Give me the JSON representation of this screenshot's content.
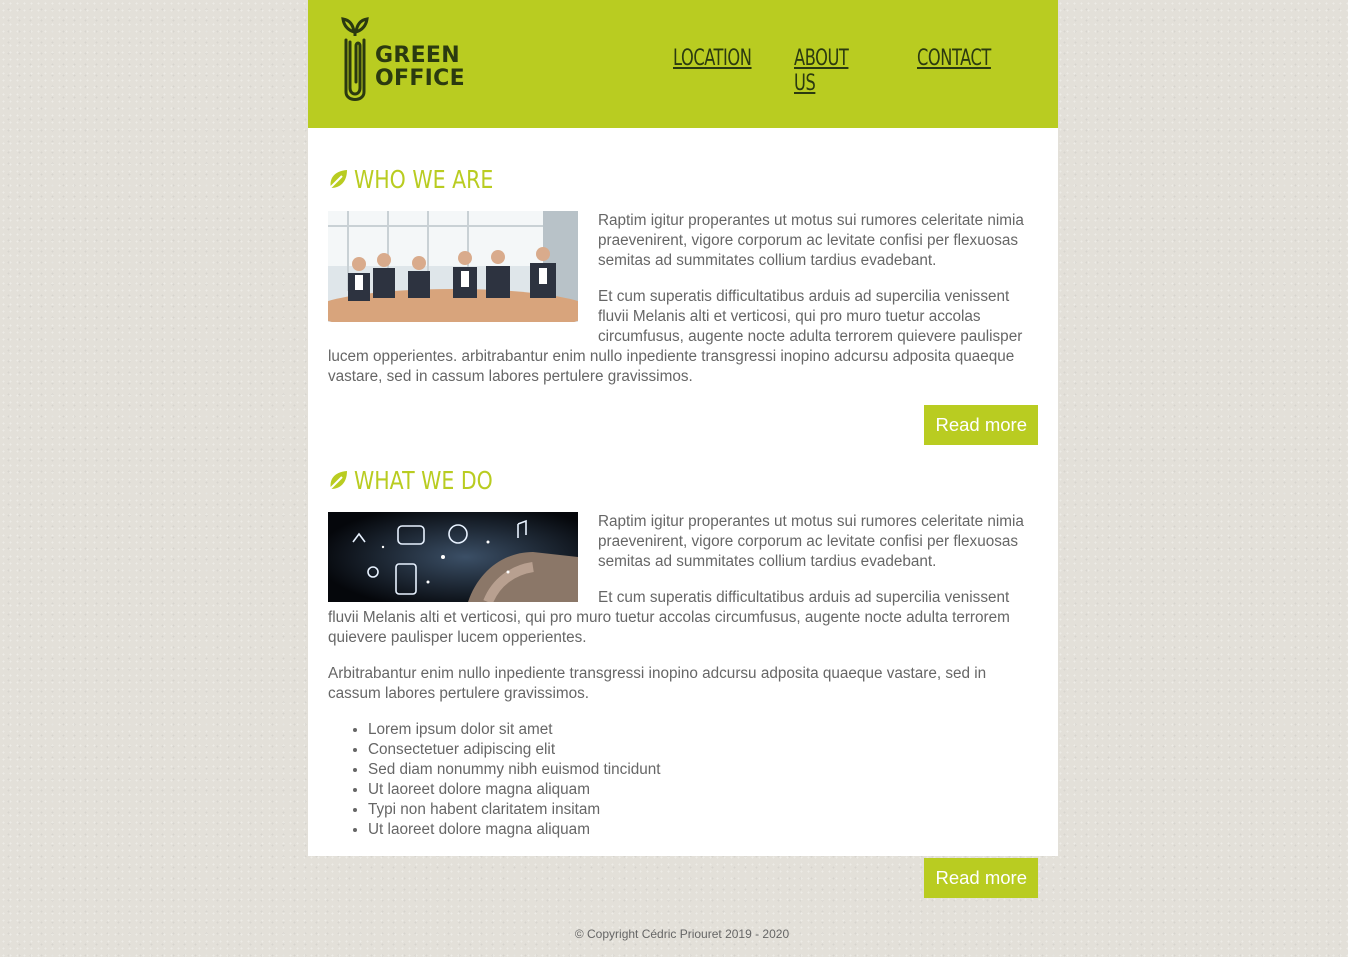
{
  "logo": {
    "line1": "GREEN",
    "line2": "OFFICE"
  },
  "nav": [
    "LOCATION",
    "ABOUT US",
    "CONTACT"
  ],
  "colors": {
    "accent": "#b9cc21",
    "dark": "#2b3a10",
    "text": "#666666",
    "background": "#e3e0d9"
  },
  "sections": [
    {
      "title": "WHO WE ARE",
      "icon": "leaf-icon",
      "image": "business-team-photo",
      "paragraphs": [
        "Raptim igitur properantes ut motus sui rumores celeritate nimia praevenirent, vigore corporum ac levitate confisi per flexuosas semitas ad summitates collium tardius evadebant.",
        "Et cum superatis difficultatibus arduis ad supercilia venissent fluvii Melanis alti et verticosi, qui pro muro tuetur accolas circumfusus, augente nocte adulta terrorem quievere paulisper lucem opperientes. arbitrabantur enim nullo inpediente transgressi inopino adcursu adposita quaeque vastare, sed in cassum labores pertulere gravissimos."
      ],
      "button": "Read more"
    },
    {
      "title": "WHAT WE DO",
      "icon": "leaf-icon",
      "image": "digital-touch-photo",
      "paragraphs": [
        "Raptim igitur properantes ut motus sui rumores celeritate nimia praevenirent, vigore corporum ac levitate confisi per flexuosas semitas ad summitates collium tardius evadebant.",
        "Et cum superatis difficultatibus arduis ad supercilia venissent fluvii Melanis alti et verticosi, qui pro muro tuetur accolas circumfusus, augente nocte adulta terrorem quievere paulisper lucem opperientes.",
        "Arbitrabantur enim nullo inpediente transgressi inopino adcursu adposita quaeque vastare, sed in cassum labores pertulere gravissimos."
      ],
      "list": [
        "Lorem ipsum dolor sit amet",
        "Consectetuer adipiscing elit",
        "Sed diam nonummy nibh euismod tincidunt",
        "Ut laoreet dolore magna aliquam",
        "Typi non habent claritatem insitam",
        "Ut laoreet dolore magna aliquam"
      ],
      "button": "Read more"
    }
  ],
  "footer": "© Copyright Cédric Priouret 2019 - 2020"
}
